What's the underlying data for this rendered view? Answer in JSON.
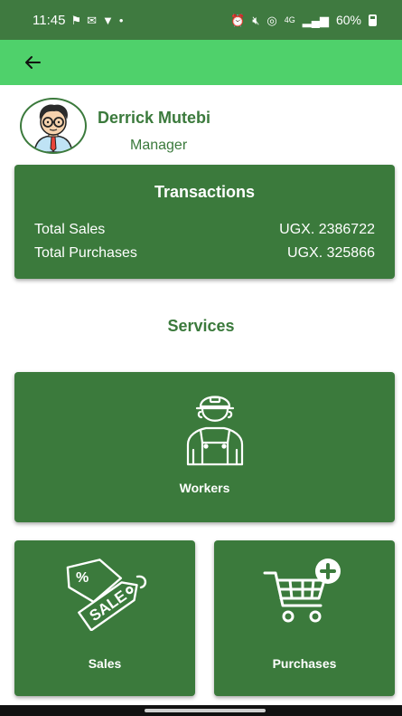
{
  "status_bar": {
    "time": "11:45",
    "battery": "60%",
    "network": "4G"
  },
  "profile": {
    "name": "Derrick Mutebi",
    "role": "Manager"
  },
  "transactions": {
    "title": "Transactions",
    "rows": [
      {
        "label": "Total Sales",
        "value": "UGX. 2386722"
      },
      {
        "label": "Total Purchases",
        "value": "UGX. 325866"
      }
    ]
  },
  "services": {
    "title": "Services",
    "tiles": [
      {
        "label": "Workers",
        "icon": "worker-icon"
      },
      {
        "label": "Sales",
        "icon": "sale-tag-icon"
      },
      {
        "label": "Purchases",
        "icon": "cart-add-icon"
      }
    ]
  },
  "colors": {
    "primary": "#3b7a3c",
    "appbar": "#4fd16b",
    "statusbar": "#3f7a40"
  }
}
